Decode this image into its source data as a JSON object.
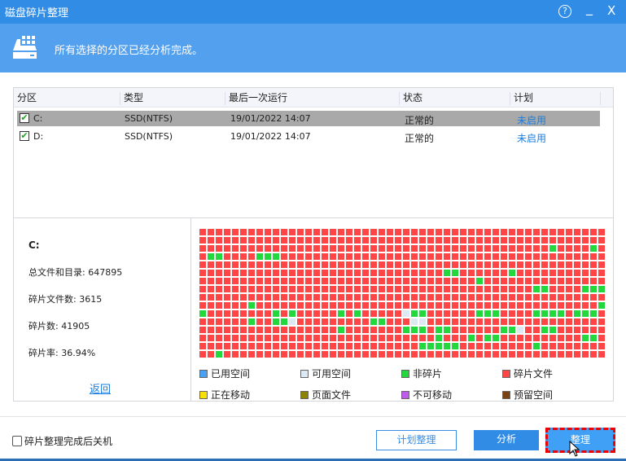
{
  "window": {
    "title": "磁盘碎片整理",
    "help": "?",
    "minimize": "_",
    "close": "X"
  },
  "banner": {
    "message": "所有选择的分区已经分析完成。"
  },
  "table": {
    "headers": [
      "分区",
      "类型",
      "最后一次运行",
      "状态",
      "计划"
    ],
    "rows": [
      {
        "checked": true,
        "partition": "C:",
        "type": "SSD(NTFS)",
        "last_run": "19/01/2022 14:07",
        "status": "正常的",
        "schedule": "未启用",
        "selected": true
      },
      {
        "checked": true,
        "partition": "D:",
        "type": "SSD(NTFS)",
        "last_run": "19/01/2022 14:07",
        "status": "正常的",
        "schedule": "未启用",
        "selected": false
      }
    ]
  },
  "info": {
    "drive": "C:",
    "total_files": "总文件和目录: 647895",
    "frag_files": "碎片文件数: 3615",
    "frags": "碎片数: 41905",
    "frag_rate": "碎片率: 36.94%",
    "back": "返回"
  },
  "map": {
    "rows": [
      "RRRRRRRRRRRRRRRRRRRRRRRRRRRRRRRRRRRRRRRRRRRRRRRRRR",
      "RRRRRRRRRRRRRRRRRRRRRRRRRRRRRRRRRRRRRRRRRRRRRRRRRR",
      "RRRRRRRRRRRRRRRRRRRRRRRRRRRRRRRRRRRRRRRRRRRGRRRRGR",
      "RGGRRRRGGGRRRRRRRRRRRRRRRRRRRRRRRRRRRRRRRRRRRRRRRR",
      "RRRRRRRRRRRRRRRRRRRRRRRRRRRRRRRRRRRRRRRRRRRRRRRRRR",
      "RRRRRRRRRRRRRRRRRRRRRRRRRRRRRRGGRRRRRRGRRRRRRRRRRR",
      "RRRRRRRRRRRRRRRRRRRRRRRRRRRRRRRRRRGRRRRRRRRRRRRRRR",
      "RRRRRRRRRRRRRRRRRRRRRRRRRRRRRRRRRRRRRRRRRGGRRRRGGG",
      "RRRRRRRRRRRRRRRRRRRRRRRRRRRRRRRRRRRRRRRRRRRRRRRRRR",
      "RRRRRRGRRRRRRRRRRRRRRRRRRRRRRRRRRRRRRRRRRRRRRRRRRG",
      "GRRRRRRRRGRGRRRRRGRGRRRRRLGGRRRRRRGGGRRRRGGGGRGGGR",
      "RRRRRRGRRGGLRRRRRRRRRGGRRRLLRRRRRRRRRRRRRRRRRRRRRR",
      "RRRRRRRRRRRRRRRRRGRRRRRRRGGGRGGRRRRRRGGLRRGGRRRRRR",
      "RRRRRRRRRRRRRRRRRRRRRRRRRRRRRGRRRGRGGRRRRRRRRRRGGR",
      "RRRRRRRRRRRRRRRRRRRRRRRRRRRGGGGGRRRRRRRRRGRRRRRRRR",
      "RRGRRRRRRRRRRRRRRRRRRRRRRRRRRRRRRRRRRRRRRRRRRRRRRR"
    ],
    "colors": {
      "R": "#ff4545",
      "G": "#22d83c",
      "L": "#dde8f5"
    }
  },
  "legend": [
    {
      "label": "已用空间",
      "color": "#4aa0f2"
    },
    {
      "label": "可用空间",
      "color": "#dde8f5"
    },
    {
      "label": "非碎片",
      "color": "#22d83c"
    },
    {
      "label": "碎片文件",
      "color": "#ff4545"
    },
    {
      "label": "正在移动",
      "color": "#f8e000"
    },
    {
      "label": "页面文件",
      "color": "#8c8400"
    },
    {
      "label": "不可移动",
      "color": "#c05af0"
    },
    {
      "label": "预留空间",
      "color": "#7a4412"
    }
  ],
  "footer": {
    "shutdown_label": "碎片整理完成后关机",
    "plan_button": "计划整理",
    "analyze_button": "分析",
    "defrag_button": "整理"
  }
}
